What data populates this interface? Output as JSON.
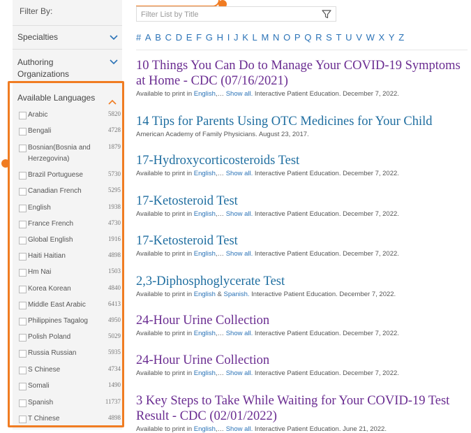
{
  "sidebar": {
    "filter_by": "Filter By:",
    "sections": [
      {
        "label": "Specialties"
      },
      {
        "label": "Authoring\nOrganizations"
      }
    ],
    "languages_header": "Available Languages",
    "languages": [
      {
        "name": "Arabic",
        "count": "5820"
      },
      {
        "name": "Bengali",
        "count": "4728"
      },
      {
        "name": "Bosnian(Bosnia and\nHerzegovina)",
        "count": "1879"
      },
      {
        "name": "Brazil Portuguese",
        "count": "5730"
      },
      {
        "name": "Canadian French",
        "count": "5295"
      },
      {
        "name": "English",
        "count": "1938"
      },
      {
        "name": "France French",
        "count": "4730"
      },
      {
        "name": "Global English",
        "count": "1916"
      },
      {
        "name": "Haiti Haitian",
        "count": "4898"
      },
      {
        "name": "Hm Nai",
        "count": "1503"
      },
      {
        "name": "Korea Korean",
        "count": "4840"
      },
      {
        "name": "Middle East Arabic",
        "count": "6413"
      },
      {
        "name": "Philippines Tagalog",
        "count": "4950"
      },
      {
        "name": "Polish Poland",
        "count": "5029"
      },
      {
        "name": "Russia Russian",
        "count": "5935"
      },
      {
        "name": "S Chinese",
        "count": "4734"
      },
      {
        "name": "Somali",
        "count": "1490"
      },
      {
        "name": "Spanish",
        "count": "11737"
      },
      {
        "name": "T Chinese",
        "count": "4898"
      }
    ]
  },
  "search": {
    "placeholder": "Filter List by Title",
    "value": ""
  },
  "alphabet": [
    "#",
    "A",
    "B",
    "C",
    "D",
    "E",
    "F",
    "G",
    "H",
    "I",
    "J",
    "K",
    "L",
    "M",
    "N",
    "O",
    "P",
    "Q",
    "R",
    "S",
    "T",
    "U",
    "V",
    "W",
    "X",
    "Y",
    "Z"
  ],
  "results": [
    {
      "title": "10 Things You Can Do to Manage Your COVID-19 Symptoms at Home - CDC (07/16/2021)",
      "visited": true,
      "meta_prefix": "Available to print in ",
      "link1": "English",
      "sep": ",… ",
      "link2": "Show all.",
      "meta_suffix": " Interactive Patient Education. December 7, 2022."
    },
    {
      "title": "14 Tips for Parents Using OTC Medicines for Your Child",
      "visited": false,
      "meta_prefix": "American Academy of Family Physicians. August 23, 2017.",
      "link1": "",
      "sep": "",
      "link2": "",
      "meta_suffix": ""
    },
    {
      "title": "17-Hydroxycorticosteroids Test",
      "visited": false,
      "meta_prefix": "Available to print in ",
      "link1": "English",
      "sep": ",… ",
      "link2": "Show all.",
      "meta_suffix": " Interactive Patient Education. December 7, 2022."
    },
    {
      "title": "17-Ketosteroid Test",
      "visited": false,
      "meta_prefix": "Available to print in ",
      "link1": "English",
      "sep": ",… ",
      "link2": "Show all.",
      "meta_suffix": " Interactive Patient Education. December 7, 2022."
    },
    {
      "title": "17-Ketosteroid Test",
      "visited": false,
      "meta_prefix": "Available to print in ",
      "link1": "English",
      "sep": ",… ",
      "link2": "Show all.",
      "meta_suffix": " Interactive Patient Education. December 7, 2022."
    },
    {
      "title": "2,3-Diphosphoglycerate Test",
      "visited": false,
      "meta_prefix": "Available to print in ",
      "link1": "English",
      "sep": " & ",
      "link2": "Spanish.",
      "meta_suffix": " Interactive Patient Education. December 7, 2022."
    },
    {
      "title": "24-Hour Urine Collection",
      "visited": true,
      "meta_prefix": "Available to print in ",
      "link1": "English",
      "sep": ",… ",
      "link2": "Show all.",
      "meta_suffix": " Interactive Patient Education. December 7, 2022."
    },
    {
      "title": "24-Hour Urine Collection",
      "visited": true,
      "meta_prefix": "Available to print in ",
      "link1": "English",
      "sep": ",… ",
      "link2": "Show all.",
      "meta_suffix": " Interactive Patient Education. December 7, 2022."
    },
    {
      "title": "3 Key Steps to Take While Waiting for Your COVID-19 Test Result - CDC (02/01/2022)",
      "visited": true,
      "meta_prefix": "Available to print in ",
      "link1": "English",
      "sep": ",… ",
      "link2": "Show all.",
      "meta_suffix": " Interactive Patient Education. June 21, 2022."
    }
  ],
  "colors": {
    "accent": "#f07c22",
    "link": "#2b73b7",
    "visited": "#6a2c91",
    "title": "#1f6ea0"
  }
}
